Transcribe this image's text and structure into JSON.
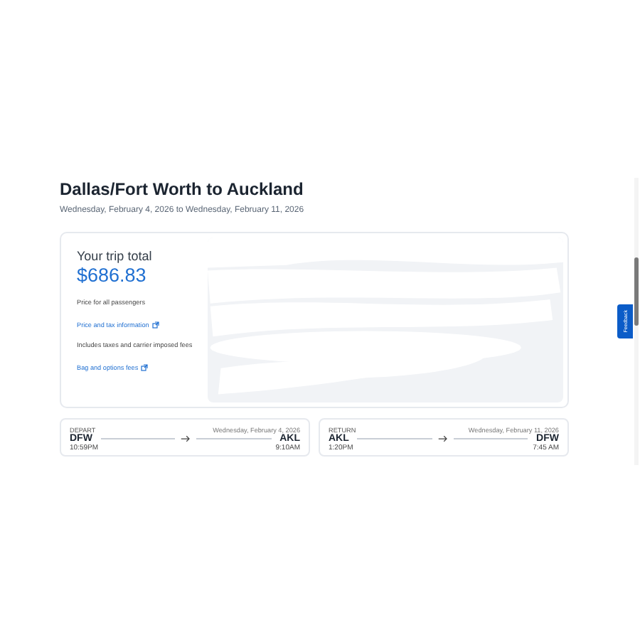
{
  "trip": {
    "title": "Dallas/Fort Worth to Auckland",
    "dates": "Wednesday, February 4, 2026 to Wednesday, February 11, 2026"
  },
  "summary": {
    "heading": "Your trip total",
    "total": "$686.83",
    "notes": [
      {
        "text": "Price for all passengers",
        "link": "Price and tax information"
      },
      {
        "text": "Includes taxes and carrier imposed fees",
        "link": "Bag and options fees"
      }
    ]
  },
  "flights": [
    {
      "label": "DEPART",
      "date": "Wednesday, February 4, 2026",
      "from": "DFW",
      "to": "AKL",
      "depart_time": "10:59PM",
      "arrive_time": "9:10AM"
    },
    {
      "label": "RETURN",
      "date": "Wednesday, February 11, 2026",
      "from": "AKL",
      "to": "DFW",
      "depart_time": "1:20PM",
      "arrive_time": "7:45 AM"
    }
  ],
  "feedback": {
    "label": "Feedback"
  }
}
